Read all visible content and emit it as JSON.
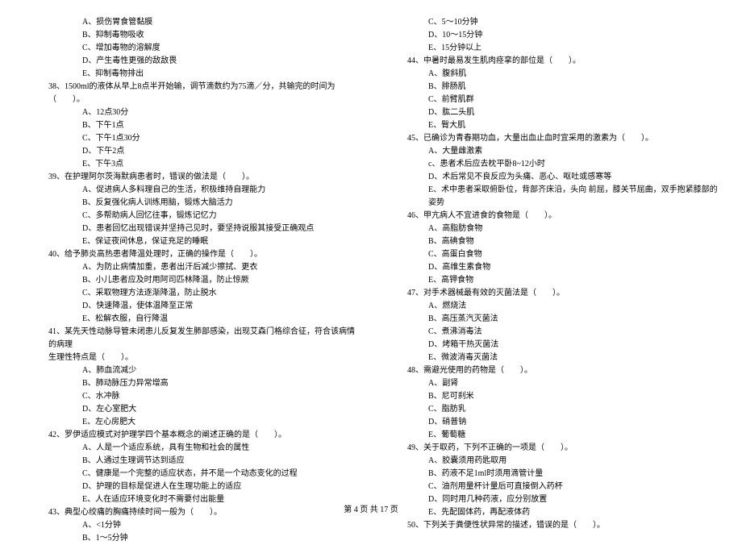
{
  "leftColumn": {
    "q37opts": {
      "A": "A、损伤胃食管黏膜",
      "B": "B、抑制毒物吸收",
      "C": "C、增加毒物的溶解度",
      "D": "D、产生毒性更强的敌敌畏",
      "E": "E、抑制毒物排出"
    },
    "q38": {
      "text": "38、1500ml的液体从早上8点半开始输，调节滴数约为75滴／分，共输完的时间为（　　）。",
      "opts": {
        "A": "A、12点30分",
        "B": "B、下午1点",
        "C": "C、下午1点30分",
        "D": "D、下午2点",
        "E": "E、下午3点"
      }
    },
    "q39": {
      "text": "39、在护理阿尔茨海默病患者时，错误的做法是（　　）。",
      "opts": {
        "A": "A、促进病人多料理自己的生活，积极维持自理能力",
        "B": "B、反复强化病人训练用脑，锻炼大脑活力",
        "C": "C、多帮助病人回忆往事，锻炼记忆力",
        "D": "D、患者回忆出现错误并坚持己见时，要坚持说服其接受正确观点",
        "E": "E、保证夜间休息，保证充足的睡眠"
      }
    },
    "q40": {
      "text": "40、给予肺炎高热患者降温处理时，正确的操作是（　　）。",
      "opts": {
        "A": "A、为防止病情加重，患者出汗后减少擦拭、更衣",
        "B": "B、小儿患者应及时用阿司匹林降温，防止惊厥",
        "C": "C、采取物理方法逐渐降温，防止脱水",
        "D": "D、快速降温，使体温降至正常",
        "E": "E、松解衣服，自行降温"
      }
    },
    "q41": {
      "text": "41、某先天性动脉导管未闭患儿反复发生肺部感染，出现艾森门格综合征，符合该病情的病理",
      "text2": "生理性特点是（　　）。",
      "opts": {
        "A": "A、肺血流减少",
        "B": "B、肺动脉压力异常增高",
        "C": "C、水冲脉",
        "D": "D、左心室肥大",
        "E": "E、左心房肥大"
      }
    },
    "q42": {
      "text": "42、罗伊适应模式对护理学四个基本概念的阐述正确的是（　　）。",
      "opts": {
        "A": "A、人是一个适应系统，具有生物和社会的属性",
        "B": "B、人通过生理调节达到适应",
        "C": "C、健康是一个完整的适应状态，并不是一个动态变化的过程",
        "D": "D、护理的目标是促进人在生理功能上的适应",
        "E": "E、人在适应环境变化时不需要付出能量"
      }
    },
    "q43": {
      "text": "43、典型心绞痛的胸痛持续时间一般为（　　）。",
      "opts": {
        "A": "A、<1分钟",
        "B": "B、1～5分钟"
      }
    }
  },
  "rightColumn": {
    "q43opts": {
      "C": "C、5～10分钟",
      "D": "D、10～15分钟",
      "E": "E、15分钟以上"
    },
    "q44": {
      "text": "44、中暑时最易发生肌肉痉挛的部位是（　　）。",
      "opts": {
        "A": "A、腹斜肌",
        "B": "B、腓肠肌",
        "C": "C、前臂肌群",
        "D": "D、肱二头肌",
        "E": "E、臀大肌"
      }
    },
    "q45": {
      "text": "45、已确诊为青春期功血，大量出血止血时宜采用的激素为（　　）。",
      "opts": {
        "A": "A、大量雌激素",
        "c": "c、患者术后应去枕平卧8~12小时",
        "D": "D、术后常见不良反应为头痛、恶心、呕吐或感寒等",
        "E": "E、术中患者采取俯卧位，背部齐床沿，头向 前屈，膝关节屈曲，双手抱紧膝部的姿势"
      }
    },
    "q46": {
      "text": "46、甲亢病人不宜进食的食物是（　　）。",
      "opts": {
        "A": "A、高脂肪食物",
        "B": "B、高碘食物",
        "C": "C、高蛋白食物",
        "D": "D、高维生素食物",
        "E": "E、高钾食物"
      }
    },
    "q47": {
      "text": "47、对手术器械最有效的灭菌法是（　　）。",
      "opts": {
        "A": "A、燃烧法",
        "B": "B、高压蒸汽灭菌法",
        "C": "C、煮沸消毒法",
        "D": "D、烤箱干热灭菌法",
        "E": "E、微波消毒灭菌法"
      }
    },
    "q48": {
      "text": "48、需避光使用的药物是（　　）。",
      "opts": {
        "A": "A、副肾",
        "B": "B、尼可刹米",
        "C": "C、脂肪乳",
        "D": "D、硝普钠",
        "E": "E、葡萄糖"
      }
    },
    "q49": {
      "text": "49、关于取药，下列不正确的一项是（　　）。",
      "opts": {
        "A": "A、胶囊须用药匙取用",
        "B": "B、药液不足1ml时须用滴管计量",
        "C": "C、油剂用量杯计量后可直接倒入药杯",
        "D": "D、同时用几种药液，应分别放置",
        "E": "E、先配固体药，再配液体药"
      }
    },
    "q50": {
      "text": "50、下列关于粪便性状异常的描述，错误的是（　　）。"
    }
  },
  "footer": "第 4 页 共 17 页"
}
